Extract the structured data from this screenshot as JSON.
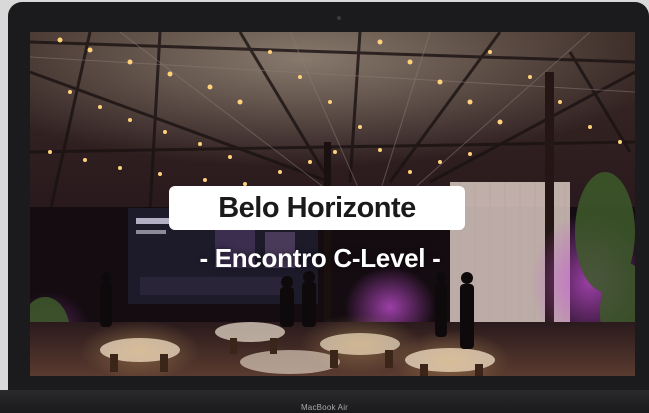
{
  "photo": {
    "title": "Belo Horizonte",
    "subtitle": "- Encontro C-Level -"
  },
  "device": {
    "model": "MacBook Air"
  }
}
